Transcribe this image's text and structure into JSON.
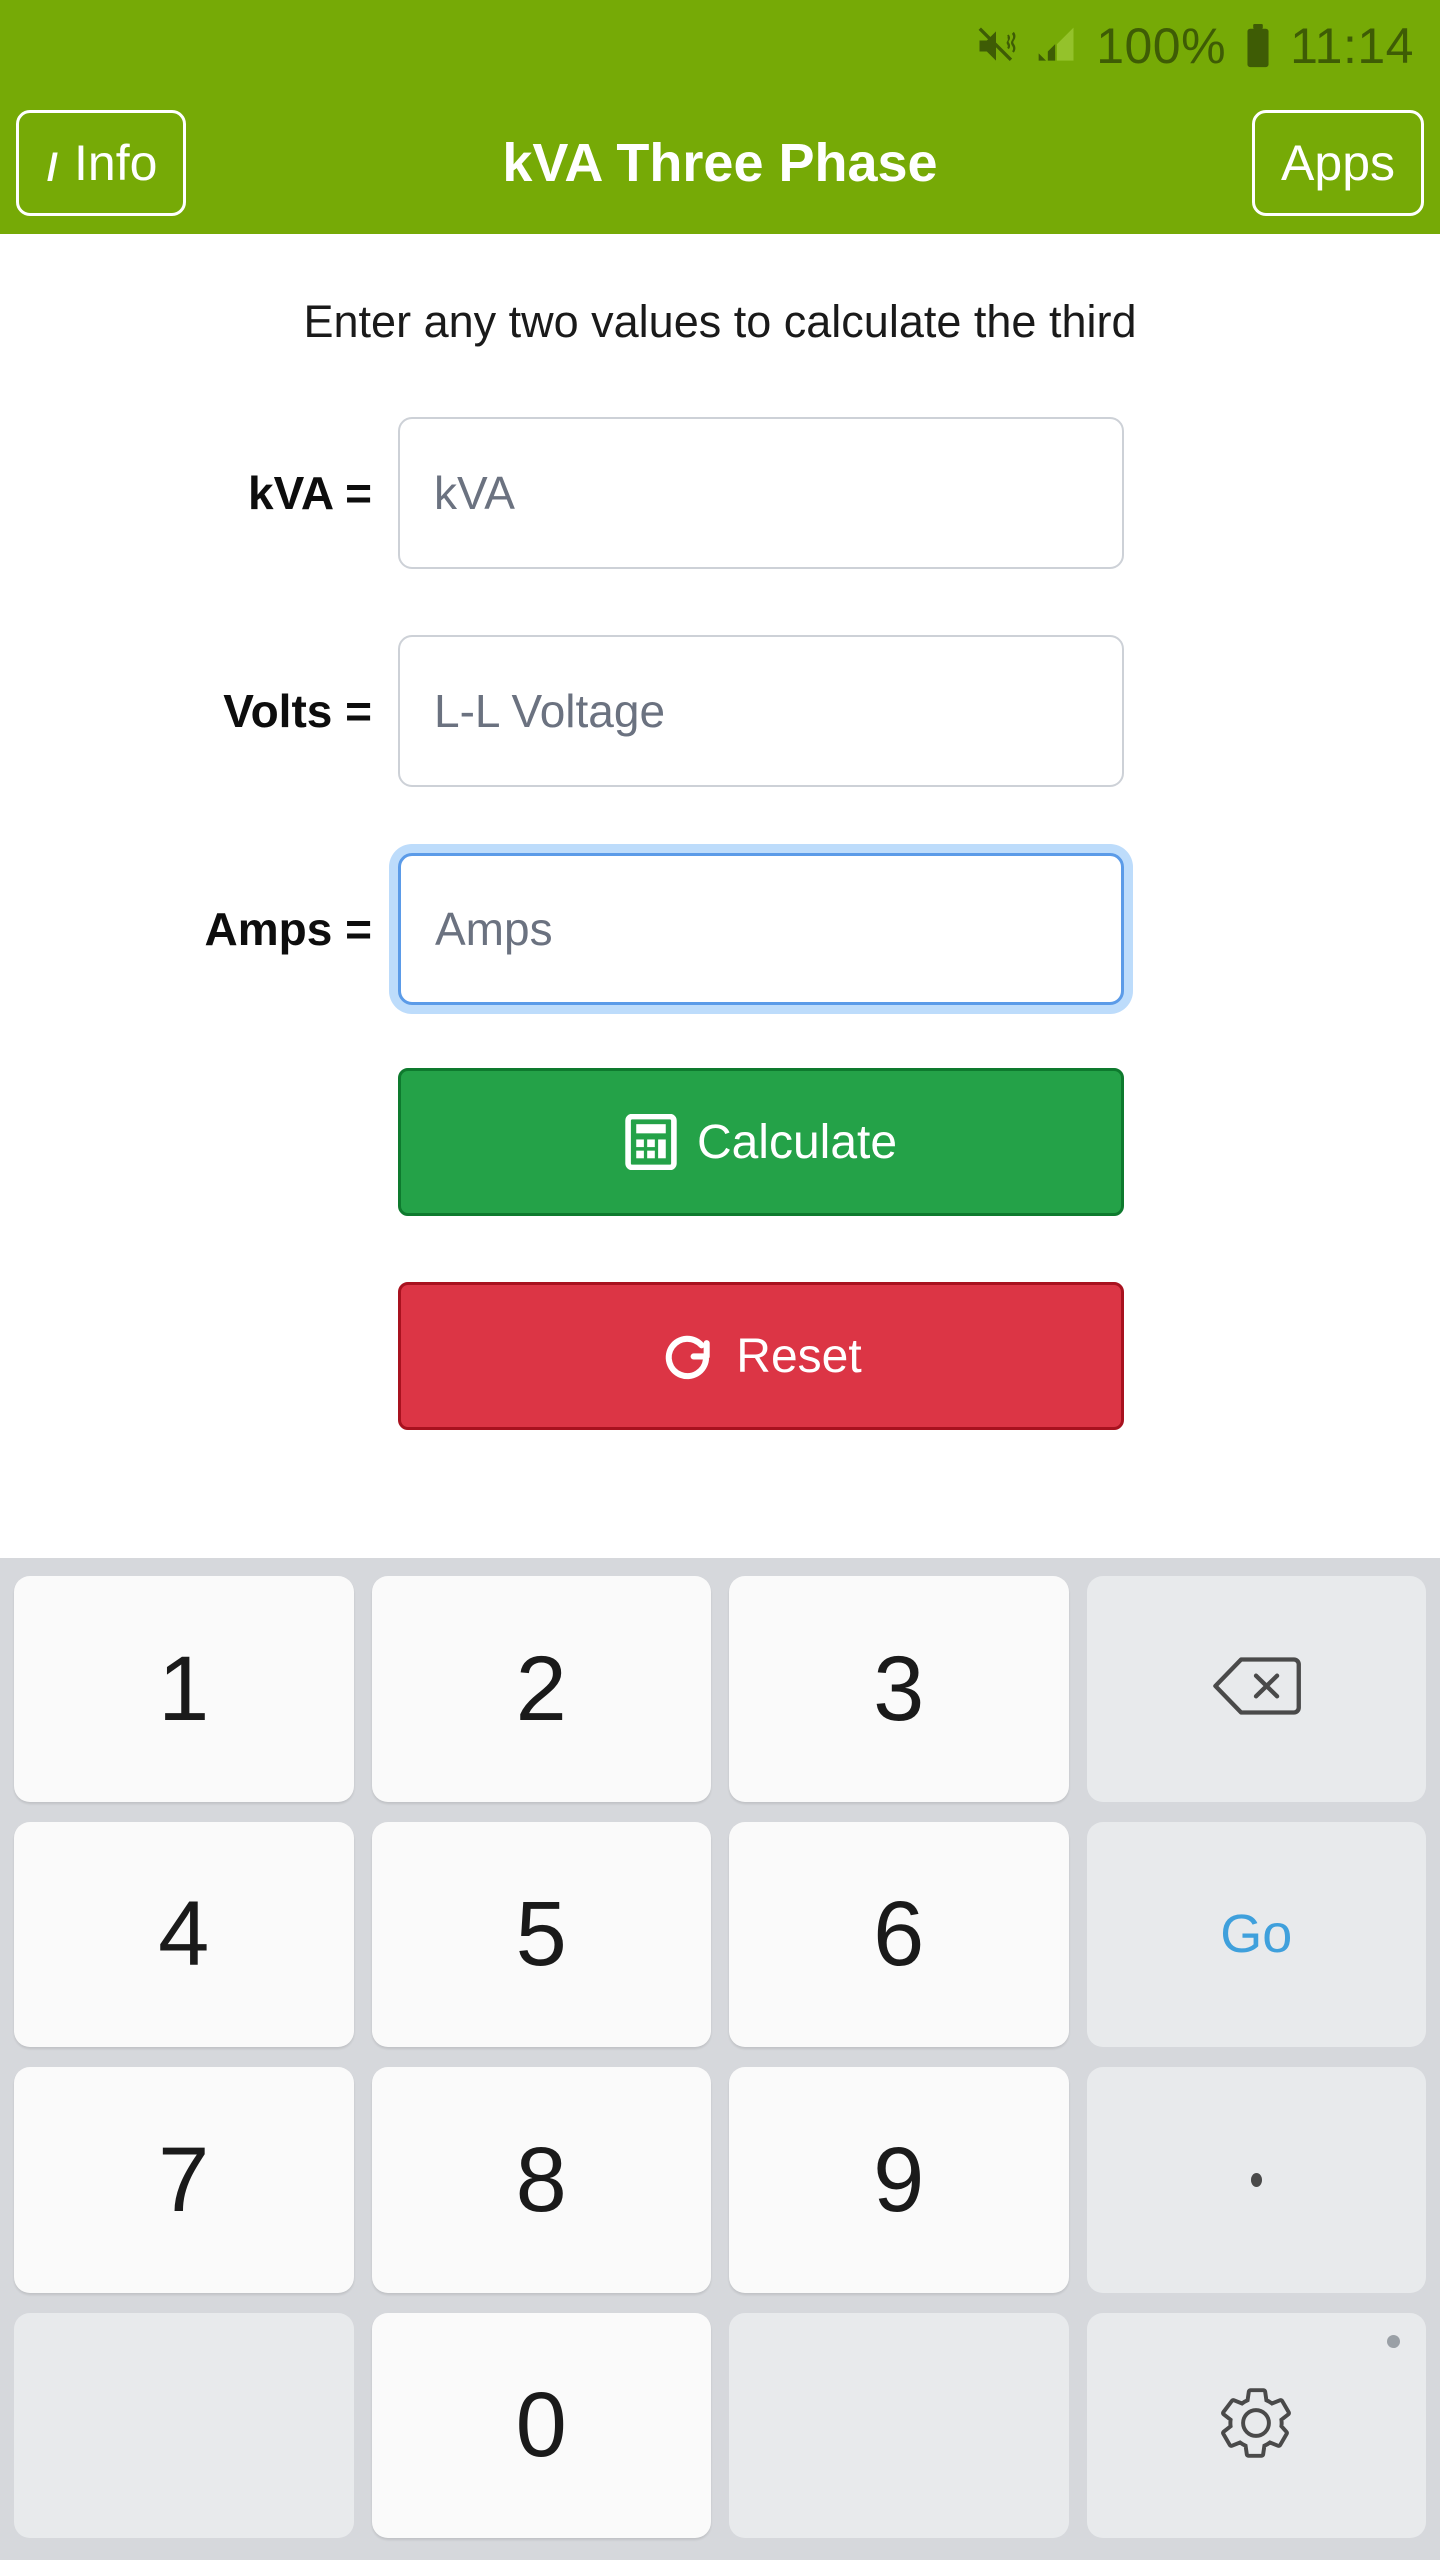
{
  "status_bar": {
    "icons": [
      "mute-vibrate-icon",
      "signal-bars-icon"
    ],
    "battery_percent": "100%",
    "battery_icon": "battery-full-icon",
    "time": "11:14",
    "bar_color": "#76AA06",
    "icon_color": "#3E5C05"
  },
  "header": {
    "title": "kVA Three Phase",
    "info_button_label": "Info",
    "info_icon": "info-italic-i-icon",
    "apps_button_label": "Apps",
    "bar_color": "#76AA06",
    "text_color": "#FFFFFF"
  },
  "main": {
    "subtitle": "Enter any two values to calculate the third",
    "fields": [
      {
        "label": "kVA =",
        "placeholder": "kVA",
        "value": "",
        "focused": false
      },
      {
        "label": "Volts =",
        "placeholder": "L-L Voltage",
        "value": "",
        "focused": false
      },
      {
        "label": "Amps =",
        "placeholder": "Amps",
        "value": "",
        "focused": true
      }
    ],
    "calculate_button": {
      "label": "Calculate",
      "icon": "calculator-icon",
      "bg_color": "#24A248",
      "border_color": "#0E7A2E"
    },
    "reset_button": {
      "label": "Reset",
      "icon": "refresh-clockwise-icon",
      "bg_color": "#DC3545",
      "border_color": "#A8121F"
    }
  },
  "keyboard": {
    "bg_color": "#D6D8DC",
    "digit_key_color": "#FAFAFA",
    "func_key_color": "#E8EAEC",
    "go_text_color": "#3FA0DC",
    "rows": [
      [
        {
          "label": "1",
          "type": "digit",
          "name": "key-1"
        },
        {
          "label": "2",
          "type": "digit",
          "name": "key-2"
        },
        {
          "label": "3",
          "type": "digit",
          "name": "key-3"
        },
        {
          "label": "",
          "type": "backspace",
          "name": "key-backspace",
          "icon": "backspace-icon"
        }
      ],
      [
        {
          "label": "4",
          "type": "digit",
          "name": "key-4"
        },
        {
          "label": "5",
          "type": "digit",
          "name": "key-5"
        },
        {
          "label": "6",
          "type": "digit",
          "name": "key-6"
        },
        {
          "label": "Go",
          "type": "go",
          "name": "key-go"
        }
      ],
      [
        {
          "label": "7",
          "type": "digit",
          "name": "key-7"
        },
        {
          "label": "8",
          "type": "digit",
          "name": "key-8"
        },
        {
          "label": "9",
          "type": "digit",
          "name": "key-9"
        },
        {
          "label": ".",
          "type": "period",
          "name": "key-period"
        }
      ],
      [
        {
          "label": "",
          "type": "blank",
          "name": "key-blank-left"
        },
        {
          "label": "0",
          "type": "digit",
          "name": "key-0"
        },
        {
          "label": "",
          "type": "blank",
          "name": "key-blank-right"
        },
        {
          "label": "",
          "type": "settings",
          "name": "key-settings",
          "icon": "gear-icon"
        }
      ]
    ]
  }
}
